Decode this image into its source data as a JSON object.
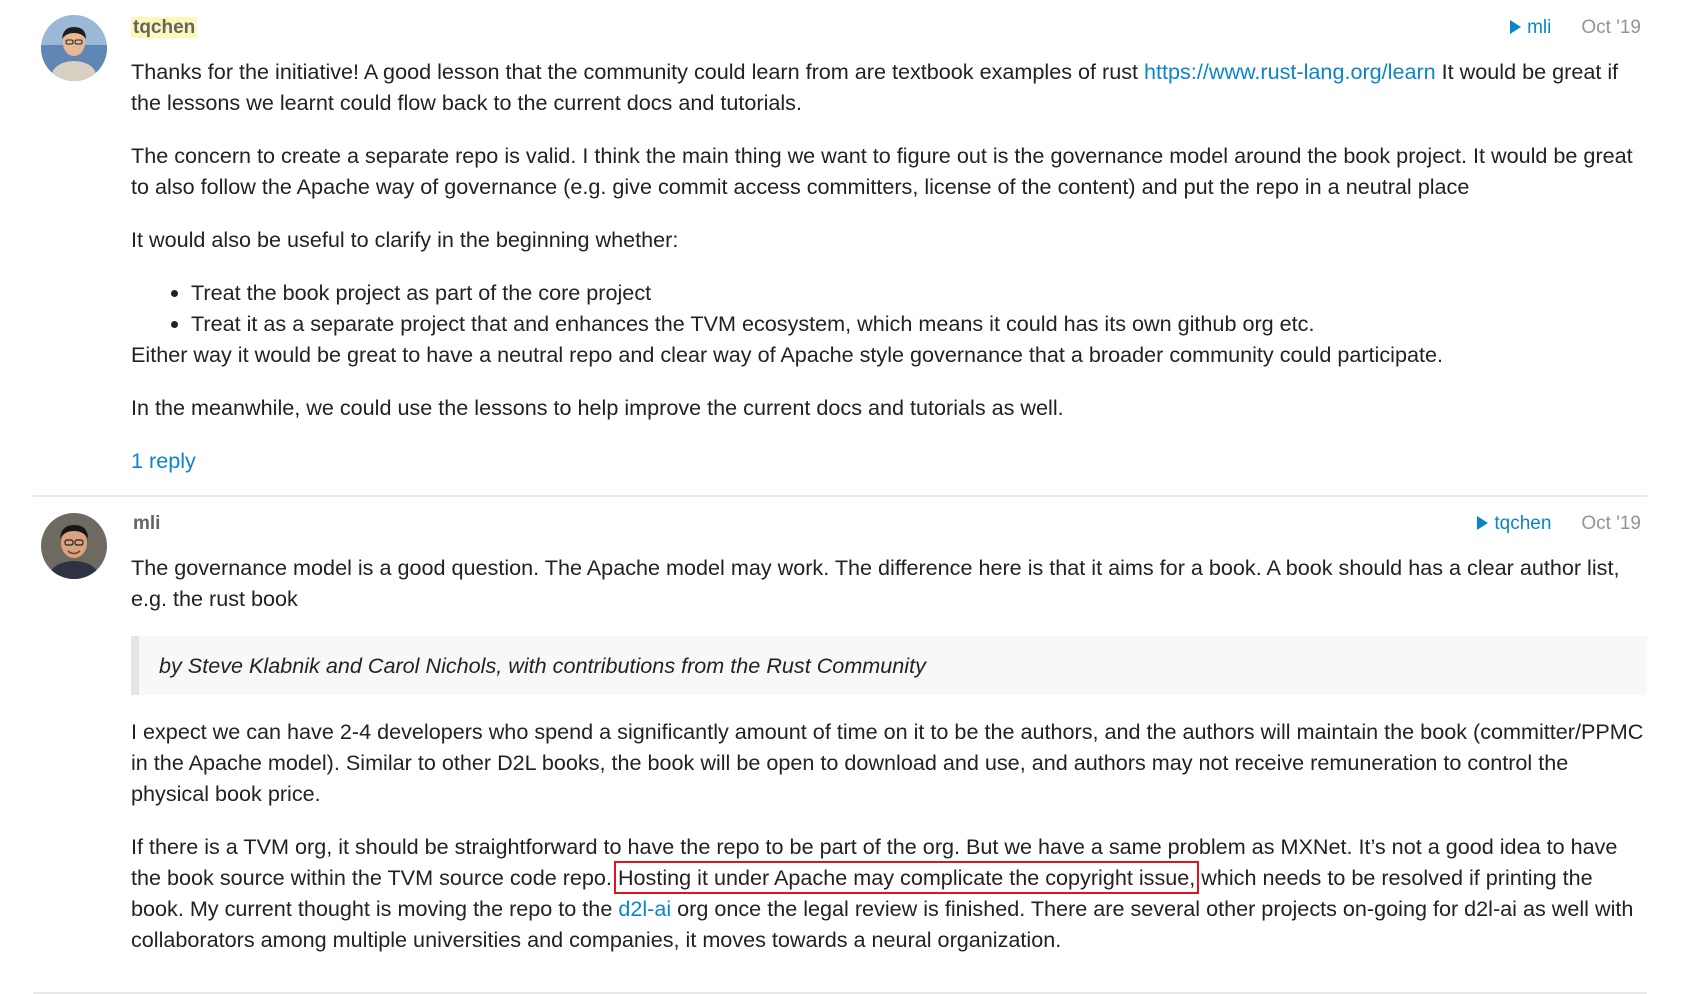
{
  "posts": [
    {
      "username": "tqchen",
      "reply_to": "mli",
      "date": "Oct '19",
      "p1_before_link": "Thanks for the initiative! A good lesson that the community could learn from are textbook examples of rust ",
      "p1_link": "https://www.rust-lang.org/learn",
      "p1_after_link": " It would be great if the lessons we learnt could flow back to the current docs and tutorials.",
      "p2": "The concern to create a separate repo is valid. I think the main thing we want to figure out is the governance model around the book project. It would be great to also follow the Apache way of governance (e.g. give commit access committers, license of the content) and put the repo in a neutral place",
      "p3": "It would also be useful to clarify in the beginning whether:",
      "list": [
        "Treat the book project as part of the core project",
        "Treat it as a separate project that and enhances the TVM ecosystem, which means it could has its own github org etc."
      ],
      "p4": "Either way it would be great to have a neutral repo and clear way of Apache style governance that a broader community could participate.",
      "p5": "In the meanwhile, we could use the lessons to help improve the current docs and tutorials as well.",
      "replies": "1 reply"
    },
    {
      "username": "mli",
      "reply_to": "tqchen",
      "date": "Oct '19",
      "p1": "The governance model is a good question. The Apache model may work. The difference here is that it aims for a book. A book should has a clear author list, e.g. the rust book",
      "quote": "by Steve Klabnik and Carol Nichols, with contributions from the Rust Community",
      "p2": "I expect we can have 2-4 developers who spend a significantly amount of time on it to be the authors, and the authors will maintain the book (committer/PPMC in the Apache model). Similar to other D2L books, the book will be open to download and use, and authors may not receive remuneration to control the physical book price.",
      "p3_a": "If there is a TVM org, it should be straightforward to have the repo to be part of the org. But we have a same problem as MXNet. It’s not a good idea to have the book source within the TVM source code repo. ",
      "p3_highlight": "Hosting it under Apache may complicate the copyright issue,",
      "p3_b": " which needs to be resolved if printing the book. My current thought is moving the repo to the ",
      "p3_link": "d2l-ai",
      "p3_c": " org once the legal review is finished. There are several other projects on-going for d2l-ai as well with collaborators among multiple universities and companies, it moves towards a neural organization."
    }
  ],
  "colors": {
    "link": "#0a85c9",
    "username_highlight": "#fdf8b9",
    "annotation_box": "#e0141e",
    "date": "#949494"
  }
}
